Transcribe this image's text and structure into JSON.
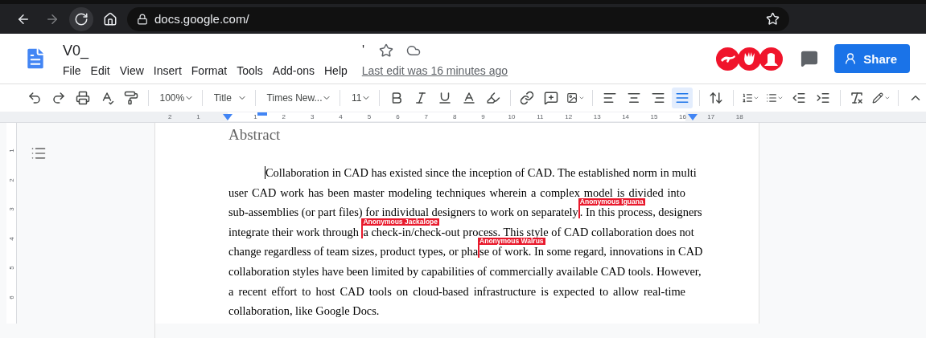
{
  "browser": {
    "url": "docs.google.com/",
    "forward_disabled": true
  },
  "document": {
    "title": "V0_",
    "title_fragment": "'",
    "menu": [
      "File",
      "Edit",
      "View",
      "Insert",
      "Format",
      "Tools",
      "Add-ons",
      "Help"
    ],
    "last_edit": "Last edit was 16 minutes ago",
    "share": "Share"
  },
  "toolbar": {
    "zoom": "100%",
    "style": "Title",
    "font": "Times New...",
    "size": "11",
    "alignment": [
      {
        "selected": false
      },
      {
        "selected": false
      },
      {
        "selected": false
      },
      {
        "selected": true
      }
    ]
  },
  "ruler": {
    "labels": [
      "2",
      "1",
      "1",
      "2",
      "3",
      "4",
      "5",
      "6",
      "7",
      "8",
      "9",
      "10",
      "11",
      "12",
      "13",
      "14",
      "15",
      "16",
      "17",
      "18"
    ],
    "vertical_labels": [
      "1",
      "2",
      "3",
      "4",
      "5",
      "6"
    ]
  },
  "page": {
    "heading": "Abstract",
    "lines": [
      {
        "segments": [
          {
            "kind": "caret"
          },
          {
            "kind": "text",
            "text": "Collaboration in CAD has existed since the inception of CAD. The established norm in multi"
          }
        ]
      },
      {
        "segments": [
          {
            "kind": "text",
            "text": "user CAD work has been master modeling techniques wherein a complex model is divided into"
          }
        ]
      },
      {
        "segments": [
          {
            "kind": "text",
            "text": "sub-assemblies (or part files) for individual designers to work on separately"
          },
          {
            "kind": "cursor",
            "name": "Anonymous Iguana"
          },
          {
            "kind": "text",
            "text": ". In this process, designers"
          }
        ]
      },
      {
        "segments": [
          {
            "kind": "text",
            "text": "integrate their work through "
          },
          {
            "kind": "cursor",
            "name": "Anonymous Jackalope"
          },
          {
            "kind": "text",
            "text": "a check-in/check-out process. This style of CAD collaboration does not"
          }
        ]
      },
      {
        "segments": [
          {
            "kind": "text",
            "text": "change regardless of team sizes, product types, or pha"
          },
          {
            "kind": "cursor",
            "name": "Anonymous Walrus"
          },
          {
            "kind": "text",
            "text": "se of work. In some regard, innovations in CAD"
          }
        ]
      },
      {
        "segments": [
          {
            "kind": "text",
            "text": "collaboration styles have been limited by capabilities of commercially available CAD tools. However,"
          }
        ]
      },
      {
        "segments": [
          {
            "kind": "text",
            "text": "a recent effort to host CAD tools on cloud-based infrastructure is expected to allow real-time"
          }
        ]
      },
      {
        "segments": [
          {
            "kind": "text",
            "text": "collaboration, like Google Docs."
          }
        ]
      }
    ]
  }
}
